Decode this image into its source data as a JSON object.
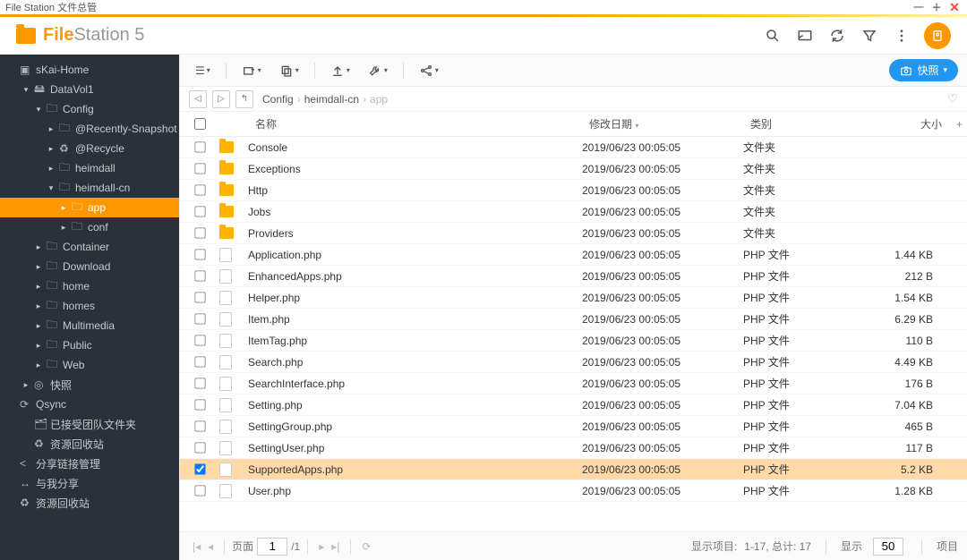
{
  "window_title": "File Station 文件总管",
  "brand": {
    "bold": "File",
    "thin": "Station",
    "ver": " 5"
  },
  "snapshot_label": "快照",
  "sidebar": [
    {
      "label": "sKai-Home",
      "lvl": 0,
      "icon": "host",
      "expand": ""
    },
    {
      "label": "DataVol1",
      "lvl": 1,
      "icon": "vol",
      "expand": "▾"
    },
    {
      "label": "Config",
      "lvl": 2,
      "icon": "folder",
      "expand": "▾"
    },
    {
      "label": "@Recently-Snapshot",
      "lvl": 3,
      "icon": "folder",
      "expand": "▸"
    },
    {
      "label": "@Recycle",
      "lvl": 3,
      "icon": "recycle",
      "expand": "▸"
    },
    {
      "label": "heimdall",
      "lvl": 3,
      "icon": "folder",
      "expand": "▸"
    },
    {
      "label": "heimdall-cn",
      "lvl": 3,
      "icon": "folder",
      "expand": "▾"
    },
    {
      "label": "app",
      "lvl": 4,
      "icon": "folder",
      "expand": "▸",
      "active": true
    },
    {
      "label": "conf",
      "lvl": 4,
      "icon": "folder",
      "expand": "▸"
    },
    {
      "label": "Container",
      "lvl": 2,
      "icon": "folder",
      "expand": "▸"
    },
    {
      "label": "Download",
      "lvl": 2,
      "icon": "folder",
      "expand": "▸"
    },
    {
      "label": "home",
      "lvl": 2,
      "icon": "folder",
      "expand": "▸"
    },
    {
      "label": "homes",
      "lvl": 2,
      "icon": "folder",
      "expand": "▸"
    },
    {
      "label": "Multimedia",
      "lvl": 2,
      "icon": "folder",
      "expand": "▸"
    },
    {
      "label": "Public",
      "lvl": 2,
      "icon": "folder",
      "expand": "▸"
    },
    {
      "label": "Web",
      "lvl": 2,
      "icon": "folder",
      "expand": "▸"
    },
    {
      "label": "快照",
      "lvl": 1,
      "icon": "snapshot",
      "expand": "▸"
    },
    {
      "label": "Qsync",
      "lvl": 0,
      "icon": "qsync",
      "expand": ""
    },
    {
      "label": "已接受团队文件夹",
      "lvl": 1,
      "icon": "team",
      "expand": ""
    },
    {
      "label": "资源回收站",
      "lvl": 1,
      "icon": "recycle",
      "expand": ""
    },
    {
      "label": "分享链接管理",
      "lvl": 0,
      "icon": "share",
      "expand": ""
    },
    {
      "label": "与我分享",
      "lvl": 0,
      "icon": "shared",
      "expand": ""
    },
    {
      "label": "资源回收站",
      "lvl": 0,
      "icon": "recycle",
      "expand": ""
    }
  ],
  "breadcrumbs": [
    "Config",
    "heimdall-cn",
    "app"
  ],
  "columns": {
    "name": "名称",
    "date": "修改日期",
    "type": "类别",
    "size": "大小"
  },
  "rows": [
    {
      "name": "Console",
      "date": "2019/06/23 00:05:05",
      "type": "文件夹",
      "size": "",
      "kind": "folder"
    },
    {
      "name": "Exceptions",
      "date": "2019/06/23 00:05:05",
      "type": "文件夹",
      "size": "",
      "kind": "folder"
    },
    {
      "name": "Http",
      "date": "2019/06/23 00:05:05",
      "type": "文件夹",
      "size": "",
      "kind": "folder"
    },
    {
      "name": "Jobs",
      "date": "2019/06/23 00:05:05",
      "type": "文件夹",
      "size": "",
      "kind": "folder"
    },
    {
      "name": "Providers",
      "date": "2019/06/23 00:05:05",
      "type": "文件夹",
      "size": "",
      "kind": "folder"
    },
    {
      "name": "Application.php",
      "date": "2019/06/23 00:05:05",
      "type": "PHP 文件",
      "size": "1.44 KB",
      "kind": "file"
    },
    {
      "name": "EnhancedApps.php",
      "date": "2019/06/23 00:05:05",
      "type": "PHP 文件",
      "size": "212 B",
      "kind": "file"
    },
    {
      "name": "Helper.php",
      "date": "2019/06/23 00:05:05",
      "type": "PHP 文件",
      "size": "1.54 KB",
      "kind": "file"
    },
    {
      "name": "Item.php",
      "date": "2019/06/23 00:05:05",
      "type": "PHP 文件",
      "size": "6.29 KB",
      "kind": "file"
    },
    {
      "name": "ItemTag.php",
      "date": "2019/06/23 00:05:05",
      "type": "PHP 文件",
      "size": "110 B",
      "kind": "file"
    },
    {
      "name": "Search.php",
      "date": "2019/06/23 00:05:05",
      "type": "PHP 文件",
      "size": "4.49 KB",
      "kind": "file"
    },
    {
      "name": "SearchInterface.php",
      "date": "2019/06/23 00:05:05",
      "type": "PHP 文件",
      "size": "176 B",
      "kind": "file"
    },
    {
      "name": "Setting.php",
      "date": "2019/06/23 00:05:05",
      "type": "PHP 文件",
      "size": "7.04 KB",
      "kind": "file"
    },
    {
      "name": "SettingGroup.php",
      "date": "2019/06/23 00:05:05",
      "type": "PHP 文件",
      "size": "465 B",
      "kind": "file"
    },
    {
      "name": "SettingUser.php",
      "date": "2019/06/23 00:05:05",
      "type": "PHP 文件",
      "size": "117 B",
      "kind": "file"
    },
    {
      "name": "SupportedApps.php",
      "date": "2019/06/23 00:05:05",
      "type": "PHP 文件",
      "size": "5.2 KB",
      "kind": "file",
      "selected": true
    },
    {
      "name": "User.php",
      "date": "2019/06/23 00:05:05",
      "type": "PHP 文件",
      "size": "1.28 KB",
      "kind": "file"
    }
  ],
  "pager": {
    "label": "页面",
    "page": "1",
    "total": "/1"
  },
  "status": {
    "show_items": "显示项目:",
    "range": "1-17, 总计: 17",
    "show": "显示",
    "per": "50",
    "item_word": "项目"
  }
}
